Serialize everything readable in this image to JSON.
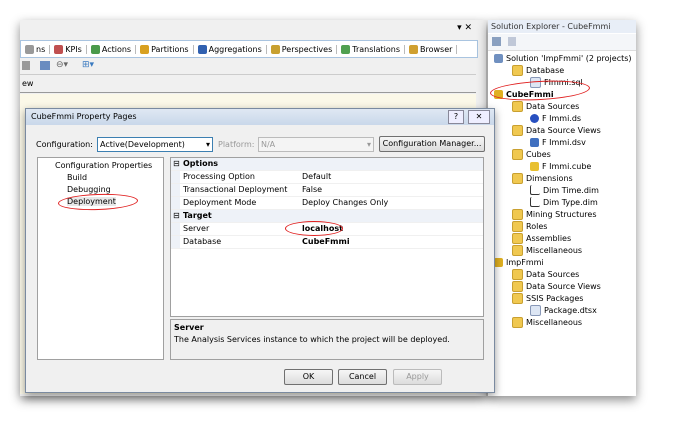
{
  "ide": {
    "close_glyphs": "▾ ✕",
    "tabs": [
      {
        "label": "ns",
        "color": "#999"
      },
      {
        "label": "KPIs",
        "color": "#c05050"
      },
      {
        "label": "Actions",
        "color": "#4a9a4a"
      },
      {
        "label": "Partitions",
        "color": "#d8a020"
      },
      {
        "label": "Aggregations",
        "color": "#3060b0"
      },
      {
        "label": "Perspectives",
        "color": "#c8a030"
      },
      {
        "label": "Translations",
        "color": "#50a050"
      },
      {
        "label": "Browser",
        "color": "#d0a030"
      }
    ],
    "subtab": "ew"
  },
  "solution_explorer": {
    "title": "Solution Explorer - CubeFmmi",
    "items": [
      {
        "label": "Solution 'ImpFmmi' (2 projects)",
        "level": 0,
        "icon": "solution-icon"
      },
      {
        "label": "Database",
        "level": 1,
        "icon": "folder-icon"
      },
      {
        "label": "FImmi.sql",
        "level": 2,
        "icon": "file-icon"
      },
      {
        "label": "CubeFmmi",
        "level": 0,
        "icon": "project-icon",
        "bold": true
      },
      {
        "label": "Data Sources",
        "level": 1,
        "icon": "folder-icon"
      },
      {
        "label": "F Immi.ds",
        "level": 2,
        "icon": "datasource-icon"
      },
      {
        "label": "Data Source Views",
        "level": 1,
        "icon": "folder-icon"
      },
      {
        "label": "F Immi.dsv",
        "level": 2,
        "icon": "dsv-icon"
      },
      {
        "label": "Cubes",
        "level": 1,
        "icon": "folder-icon"
      },
      {
        "label": "F Immi.cube",
        "level": 2,
        "icon": "cube-icon"
      },
      {
        "label": "Dimensions",
        "level": 1,
        "icon": "folder-icon"
      },
      {
        "label": "Dim Time.dim",
        "level": 2,
        "icon": "dimension-icon"
      },
      {
        "label": "Dim Type.dim",
        "level": 2,
        "icon": "dimension-icon"
      },
      {
        "label": "Mining Structures",
        "level": 1,
        "icon": "folder-icon"
      },
      {
        "label": "Roles",
        "level": 1,
        "icon": "folder-icon"
      },
      {
        "label": "Assemblies",
        "level": 1,
        "icon": "folder-icon"
      },
      {
        "label": "Miscellaneous",
        "level": 1,
        "icon": "folder-icon"
      },
      {
        "label": "ImpFmmi",
        "level": 0,
        "icon": "project-icon"
      },
      {
        "label": "Data Sources",
        "level": 1,
        "icon": "folder-icon"
      },
      {
        "label": "Data Source Views",
        "level": 1,
        "icon": "folder-icon"
      },
      {
        "label": "SSIS Packages",
        "level": 1,
        "icon": "folder-icon"
      },
      {
        "label": "Package.dtsx",
        "level": 2,
        "icon": "file-icon"
      },
      {
        "label": "Miscellaneous",
        "level": 1,
        "icon": "folder-icon"
      }
    ]
  },
  "dialog": {
    "title": "CubeFmmi Property Pages",
    "help": "?",
    "close": "✕",
    "configuration_label": "Configuration:",
    "configuration_value": "Active(Development)",
    "platform_label": "Platform:",
    "platform_value": "N/A",
    "config_manager": "Configuration Manager...",
    "tree": {
      "root": "Configuration Properties",
      "items": [
        "Build",
        "Debugging",
        "Deployment"
      ]
    },
    "groups": [
      {
        "name": "Options",
        "rows": [
          [
            "Processing Option",
            "Default"
          ],
          [
            "Transactional Deployment",
            "False"
          ],
          [
            "Deployment Mode",
            "Deploy Changes Only"
          ]
        ]
      },
      {
        "name": "Target",
        "rows": [
          [
            "Server",
            "localhost"
          ],
          [
            "Database",
            "CubeFmmi"
          ]
        ]
      }
    ],
    "desc_title": "Server",
    "desc_text": "The Analysis Services instance to which the project will be deployed.",
    "ok": "OK",
    "cancel": "Cancel",
    "apply": "Apply"
  }
}
